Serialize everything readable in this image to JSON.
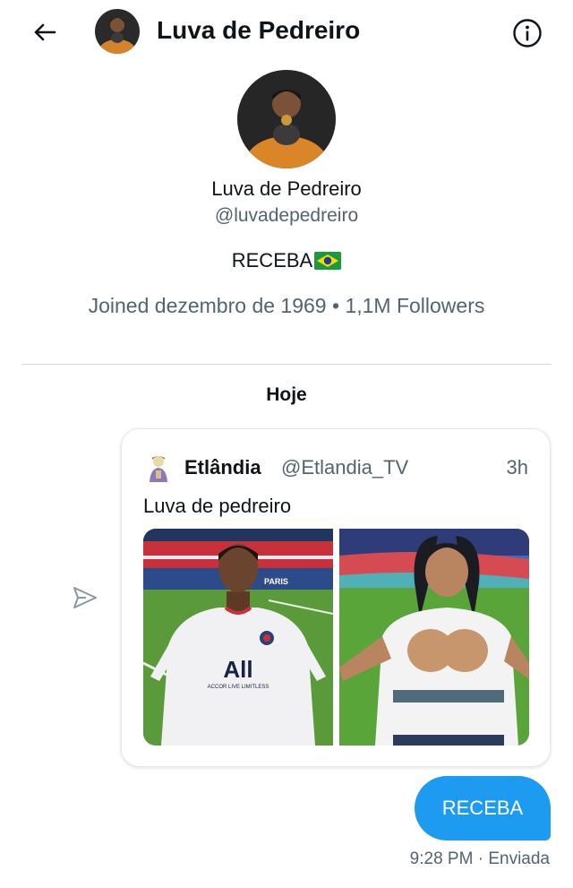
{
  "header": {
    "title": "Luva de Pedreiro"
  },
  "profile": {
    "name": "Luva de Pedreiro",
    "handle": "@luvadepedreiro",
    "bio": "RECEBA",
    "joined": "Joined dezembro de 1969",
    "separator": " • ",
    "followers": "1,1M Followers"
  },
  "conversation": {
    "day_label": "Hoje",
    "shared_tweet": {
      "author": "Etlândia",
      "handle": "@Etlandia_TV",
      "time": "3h",
      "text": "Luva de pedreiro",
      "left_image": {
        "jersey_text": "All",
        "jersey_subtext": "ACCOR LIVE LIMITLESS",
        "stadium_text": "PARIS"
      }
    },
    "sent_message": {
      "text": "RECEBA",
      "time": "9:28 PM",
      "meta_separator": " · ",
      "status": "Enviada"
    }
  },
  "colors": {
    "accent": "#1d9bf0",
    "secondary_text": "#536471",
    "divider": "#cfd9de"
  }
}
